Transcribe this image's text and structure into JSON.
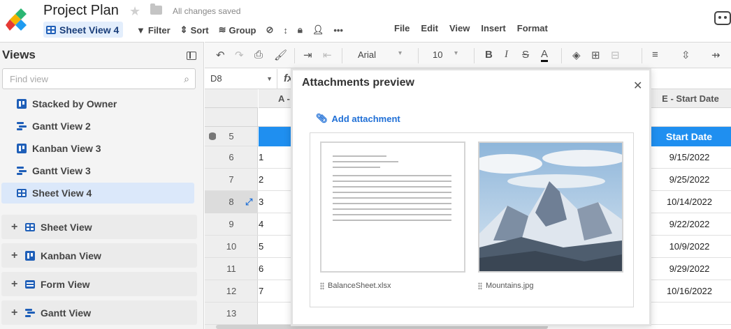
{
  "app": {
    "title": "Project Plan",
    "save_status": "All changes saved",
    "current_view": "Sheet View 4"
  },
  "toolbar": {
    "filter": "Filter",
    "sort": "Sort",
    "group": "Group"
  },
  "menu": [
    "File",
    "Edit",
    "View",
    "Insert",
    "Format"
  ],
  "views_panel": {
    "title": "Views",
    "search_placeholder": "Find view",
    "views": [
      {
        "label": "Stacked by Owner",
        "icon": "kanban-icon"
      },
      {
        "label": "Gantt View 2",
        "icon": "gantt-icon"
      },
      {
        "label": "Kanban View 3",
        "icon": "kanban-icon"
      },
      {
        "label": "Gantt View 3",
        "icon": "gantt-icon"
      },
      {
        "label": "Sheet View 4",
        "icon": "sheet-icon",
        "active": true
      }
    ],
    "create": [
      {
        "label": "Sheet View",
        "icon": "sheet-icon"
      },
      {
        "label": "Kanban View",
        "icon": "kanban-icon"
      },
      {
        "label": "Form View",
        "icon": "form-icon"
      },
      {
        "label": "Gantt View",
        "icon": "gantt-icon"
      }
    ]
  },
  "format_toolbar": {
    "font": "Arial",
    "font_size": "10"
  },
  "formula_bar": {
    "cell_ref": "D8",
    "fx": "fx"
  },
  "grid": {
    "col_a_header": "A -",
    "col_e_header": "E - Start Date",
    "header_row_number": "5",
    "header_row_label": "Start Date",
    "empty_row_number": "13",
    "rows": [
      {
        "num": "6",
        "a": "1",
        "start": "9/15/2022"
      },
      {
        "num": "7",
        "a": "2",
        "start": "9/25/2022"
      },
      {
        "num": "8",
        "a": "3",
        "start": "10/14/2022",
        "selected": true
      },
      {
        "num": "9",
        "a": "4",
        "start": "9/22/2022"
      },
      {
        "num": "10",
        "a": "5",
        "start": "10/9/2022"
      },
      {
        "num": "11",
        "a": "6",
        "start": "9/29/2022"
      },
      {
        "num": "12",
        "a": "7",
        "start": "10/16/2022"
      }
    ]
  },
  "modal": {
    "title": "Attachments preview",
    "add_label": "Add attachment",
    "attachments": [
      {
        "name": "BalanceSheet.xlsx",
        "type": "spreadsheet"
      },
      {
        "name": "Mountains.jpg",
        "type": "image"
      }
    ]
  },
  "colors": {
    "accent": "#1f8ff0",
    "link": "#1f6fd6",
    "icon_blue": "#1f5fb8",
    "active_view_bg": "#dbe8fa"
  }
}
